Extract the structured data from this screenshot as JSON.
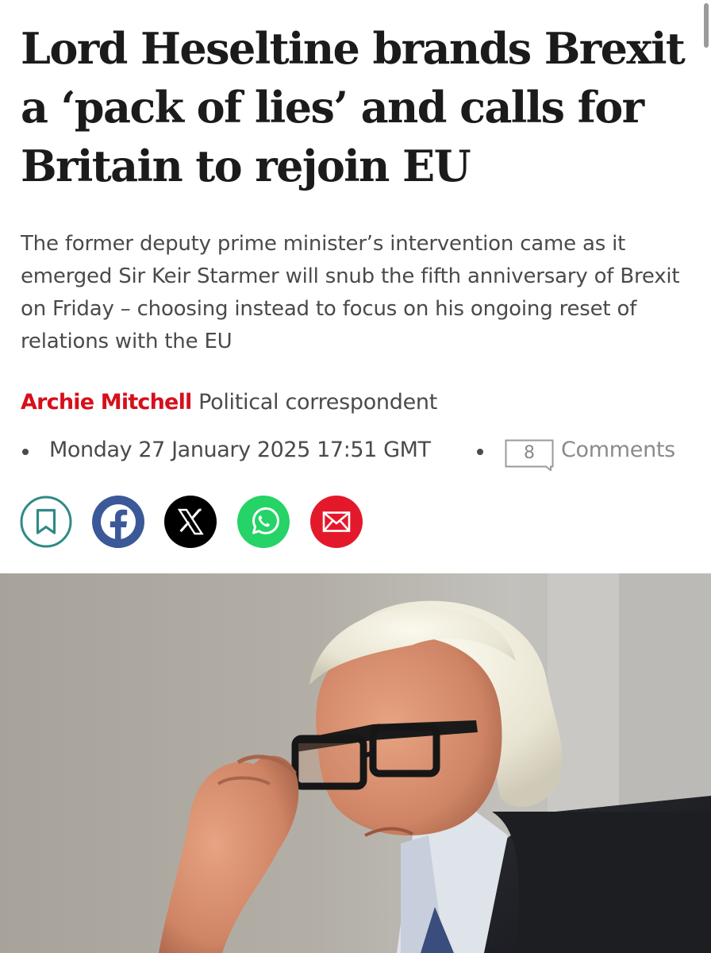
{
  "article": {
    "headline": "Lord Heseltine brands Brexit a ‘pack of lies’ and calls for Britain to rejoin EU",
    "standfirst": "The former deputy prime minister’s intervention came as it emerged Sir Keir Starmer will snub the fifth anniversary of Brexit on Friday – choosing instead to focus on his ongoing reset of relations with the EU",
    "author": "Archie Mitchell",
    "author_role": "Political correspondent",
    "date": "Monday 27 January 2025 17:51 GMT",
    "comment_count": "8",
    "comments_label": "Comments"
  },
  "share_buttons": [
    {
      "name": "save",
      "icon": "bookmark-icon",
      "color": "#2f8a86"
    },
    {
      "name": "facebook",
      "icon": "facebook-icon",
      "color": "#3b5998"
    },
    {
      "name": "x",
      "icon": "x-icon",
      "color": "#000000"
    },
    {
      "name": "whatsapp",
      "icon": "whatsapp-icon",
      "color": "#25d366"
    },
    {
      "name": "email",
      "icon": "envelope-icon",
      "color": "#e3192b"
    }
  ],
  "colors": {
    "author": "#d6101c",
    "text": "#1b1b1b",
    "muted": "#4a4a4a"
  }
}
